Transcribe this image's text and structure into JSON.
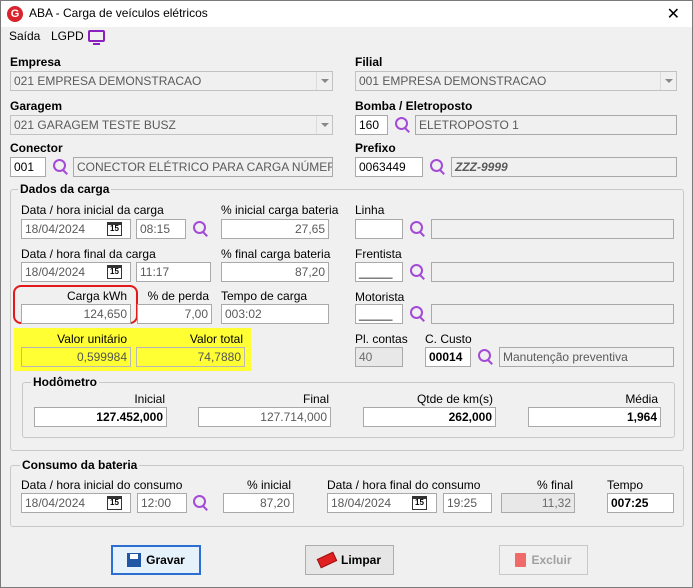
{
  "window": {
    "title": "ABA - Carga de veículos elétricos",
    "app_icon": "G",
    "close": "✕"
  },
  "menu": {
    "saida": "Saída",
    "lgpd": "LGPD"
  },
  "empresa": {
    "label": "Empresa",
    "value": "021 EMPRESA DEMONSTRACAO"
  },
  "filial": {
    "label": "Filial",
    "value": "001 EMPRESA DEMONSTRACAO"
  },
  "garagem": {
    "label": "Garagem",
    "value": "021 GARAGEM TESTE BUSZ"
  },
  "bomba": {
    "label": "Bomba / Eletroposto",
    "code": "160",
    "desc": "ELETROPOSTO 1"
  },
  "conector": {
    "label": "Conector",
    "code": "001",
    "desc": "CONECTOR ELÉTRICO PARA CARGA NÚMERO UM"
  },
  "prefixo": {
    "label": "Prefixo",
    "code": "0063449",
    "desc": "ZZZ-9999"
  },
  "dados": {
    "title": "Dados da carga",
    "dt_ini_label": "Data / hora inicial da carga",
    "dt_ini_date": "18/04/2024",
    "dt_ini_time": "08:15",
    "pct_ini_label": "% inicial carga bateria",
    "pct_ini": "27,65",
    "dt_fim_label": "Data / hora final da carga",
    "dt_fim_date": "18/04/2024",
    "dt_fim_time": "11:17",
    "pct_fim_label": "% final carga bateria",
    "pct_fim": "87,20",
    "kwh_label": "Carga kWh",
    "kwh": "124,650",
    "perda_label": "% de perda",
    "perda": "7,00",
    "tempo_label": "Tempo de carga",
    "tempo": "003:02",
    "vu_label": "Valor unitário",
    "vu": "0,599984",
    "vt_label": "Valor total",
    "vt": "74,7880",
    "linha_label": "Linha",
    "frentista_label": "Frentista",
    "frentista": "_____",
    "motorista_label": "Motorista",
    "motorista": "_____",
    "plcontas_label": "Pl. contas",
    "plcontas": "40",
    "ccusto_label": "C. Custo",
    "ccusto_code": "00014",
    "ccusto_desc": "Manutenção preventiva"
  },
  "hodometro": {
    "title": "Hodômetro",
    "inicial_label": "Inicial",
    "inicial": "127.452,000",
    "final_label": "Final",
    "final": "127.714,000",
    "qtde_label": "Qtde de km(s)",
    "qtde": "262,000",
    "media_label": "Média",
    "media": "1,964"
  },
  "consumo": {
    "title": "Consumo da bateria",
    "dt_ini_label": "Data / hora inicial do consumo",
    "dt_ini_date": "18/04/2024",
    "dt_ini_time": "12:00",
    "pct_ini_label": "% inicial",
    "pct_ini": "87,20",
    "dt_fim_label": "Data / hora final do consumo",
    "dt_fim_date": "18/04/2024",
    "dt_fim_time": "19:25",
    "pct_fim_label": "% final",
    "pct_fim": "11,32",
    "tempo_label": "Tempo",
    "tempo": "007:25"
  },
  "buttons": {
    "gravar": "Gravar",
    "limpar": "Limpar",
    "excluir": "Excluir"
  },
  "calendar_glyph": "15",
  "colors": {
    "accent_purple": "#a34bd6",
    "highlight_yellow": "#ffff33",
    "red_outline": "#e3181a",
    "primary_blue": "#2a6fd1"
  }
}
